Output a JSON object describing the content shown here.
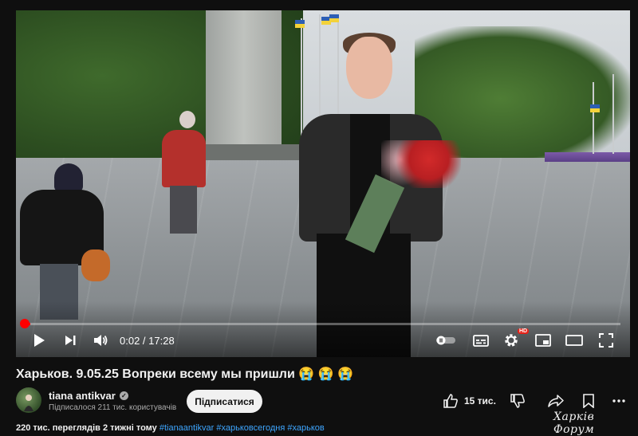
{
  "player": {
    "time_current": "0:02",
    "time_separator": " / ",
    "time_total": "17:28",
    "progress_fraction": 0.002,
    "hd_badge": "HD",
    "icons": [
      "play-icon",
      "next-icon",
      "volume-icon",
      "autoplay-toggle-icon",
      "subtitles-icon",
      "settings-icon",
      "miniplayer-icon",
      "theater-mode-icon",
      "fullscreen-icon"
    ]
  },
  "video": {
    "title": "Харьков. 9.05.25 Вопреки всему мы пришли 😭 😭 😭"
  },
  "channel": {
    "name": "tiana antikvar",
    "subscribers": "Підписалося 211 тис. користувачів",
    "subscribe_label": "Підписатися"
  },
  "actions": {
    "likes": "15 тис."
  },
  "description": {
    "stats": "220 тис. переглядів  2 тижні тому",
    "tags": "#tianaantikvar #харьковсегодня #харьков"
  },
  "watermark": "Харків Форум",
  "colors": {
    "accent": "#ff0000",
    "background": "#0f0f0f",
    "link": "#3ea6ff"
  }
}
